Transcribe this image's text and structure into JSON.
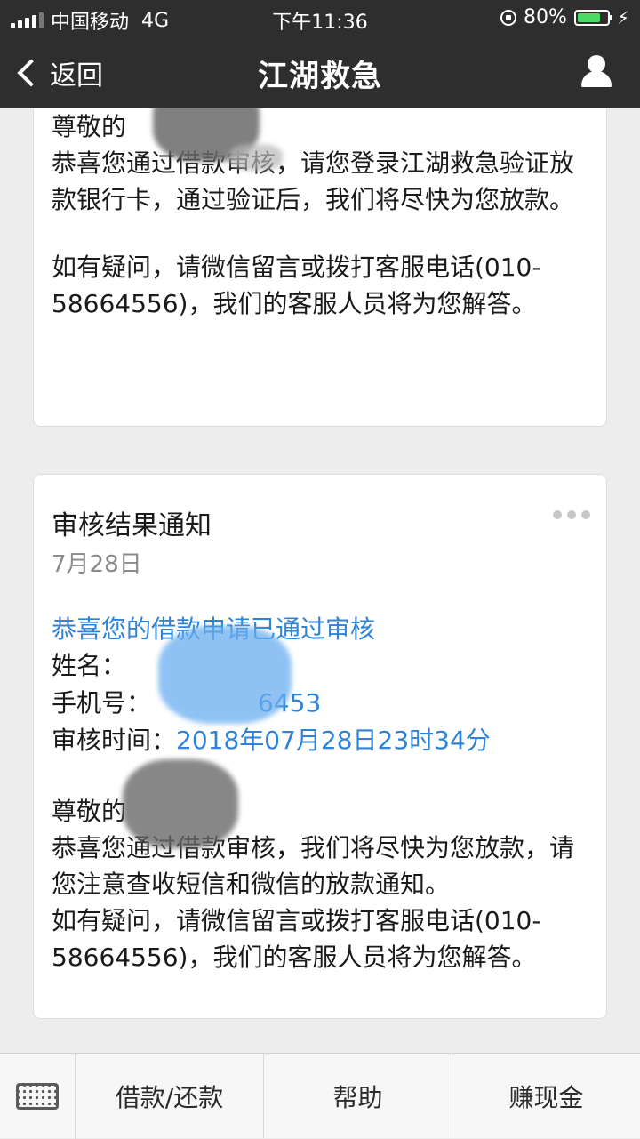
{
  "status_bar": {
    "carrier": "中国移动",
    "network": "4G",
    "time": "下午11:36",
    "battery": "80%",
    "battery_level": 0.8
  },
  "nav": {
    "back_label": "返回",
    "title": "江湖救急",
    "icons": {
      "back": "chevron-left-icon",
      "profile": "user-icon"
    }
  },
  "card1": {
    "para1": "尊敬的\n恭喜您通过借款审核，请您登录江湖救急验证放款银行卡，通过验证后，我们将尽快为您放款。",
    "para2": "如有疑问，请微信留言或拨打客服电话(010-58664556)，我们的客服人员将为您解答。"
  },
  "card2": {
    "title": "审核结果通知",
    "date": "7月28日",
    "headline": "恭喜您的借款申请已通过审核",
    "name_label": "姓名：",
    "phone_label": "手机号：",
    "phone_value": "6453",
    "time_label": "审核时间：",
    "time_value": "2018年07月28日23时34分",
    "para": "尊敬的\n恭喜您通过借款审核，我们将尽快为您放款，请您注意查收短信和微信的放款通知。\n如有疑问，请微信留言或拨打客服电话(010-58664556)，我们的客服人员将为您解答。"
  },
  "bottom_menu": {
    "items": [
      "借款/还款",
      "帮助",
      "赚现金"
    ]
  },
  "colors": {
    "bar_bg": "#2e2e2e",
    "link_blue": "#2e83d6",
    "battery_green": "#4cd964"
  }
}
